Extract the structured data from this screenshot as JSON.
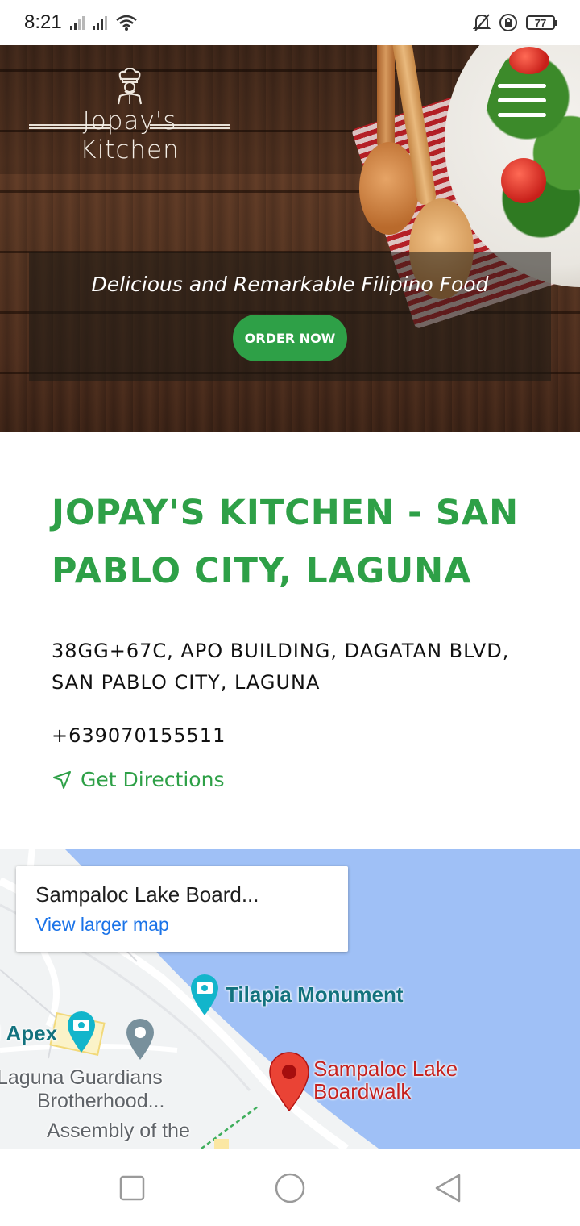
{
  "status_bar": {
    "time": "8:21",
    "battery": "77"
  },
  "header": {
    "logo_text": "Jopay's Kitchen",
    "tagline": "Delicious and Remarkable Filipino Food",
    "order_button": "ORDER NOW"
  },
  "location": {
    "title": "JOPAY'S KITCHEN - SAN PABLO CITY, LAGUNA",
    "address_line1": "38GG+67C, APO BUILDING, DAGATAN BLVD,",
    "address_line2": "SAN PABLO CITY, LAGUNA",
    "phone": "+639070155511",
    "directions_label": "Get Directions"
  },
  "map": {
    "card_title": "Sampaloc Lake Board...",
    "card_link": "View larger map",
    "labels": {
      "tilapia": "Tilapia Monument",
      "apex": "l Apex",
      "guardians_1": "Laguna Guardians",
      "guardians_2": "Brotherhood...",
      "assembly": "Assembly of the",
      "boardwalk_1": "Sampaloc Lake",
      "boardwalk_2": "Boardwalk"
    }
  },
  "colors": {
    "brand_green": "#2ea047",
    "map_water": "#9fc0f6",
    "link_blue": "#1a73e8"
  }
}
